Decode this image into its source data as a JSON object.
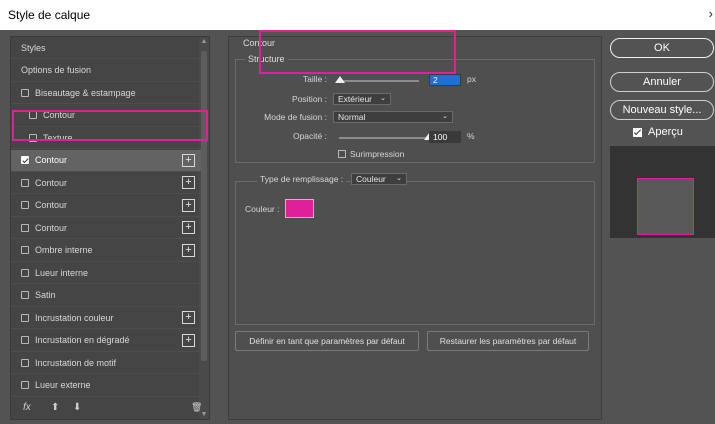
{
  "window": {
    "title": "Style de calque",
    "close_glyph": "›"
  },
  "left_panel": {
    "items": [
      {
        "label": "Styles",
        "checkbox": false,
        "checked": false,
        "plus": false,
        "selected": false
      },
      {
        "label": "Options de fusion",
        "checkbox": false,
        "checked": false,
        "plus": false,
        "selected": false
      },
      {
        "label": "Biseautage & estampage",
        "checkbox": true,
        "checked": false,
        "plus": false,
        "selected": false
      },
      {
        "label": "Contour",
        "checkbox": true,
        "checked": false,
        "plus": false,
        "selected": false,
        "indent": true
      },
      {
        "label": "Texture",
        "checkbox": true,
        "checked": false,
        "plus": false,
        "selected": false,
        "indent": true
      },
      {
        "label": "Contour",
        "checkbox": true,
        "checked": true,
        "plus": true,
        "selected": true
      },
      {
        "label": "Contour",
        "checkbox": true,
        "checked": false,
        "plus": true,
        "selected": false
      },
      {
        "label": "Contour",
        "checkbox": true,
        "checked": false,
        "plus": true,
        "selected": false
      },
      {
        "label": "Contour",
        "checkbox": true,
        "checked": false,
        "plus": true,
        "selected": false
      },
      {
        "label": "Ombre interne",
        "checkbox": true,
        "checked": false,
        "plus": true,
        "selected": false
      },
      {
        "label": "Lueur interne",
        "checkbox": true,
        "checked": false,
        "plus": false,
        "selected": false
      },
      {
        "label": "Satin",
        "checkbox": true,
        "checked": false,
        "plus": false,
        "selected": false
      },
      {
        "label": "Incrustation couleur",
        "checkbox": true,
        "checked": false,
        "plus": true,
        "selected": false
      },
      {
        "label": "Incrustation en dégradé",
        "checkbox": true,
        "checked": false,
        "plus": true,
        "selected": false
      },
      {
        "label": "Incrustation de motif",
        "checkbox": true,
        "checked": false,
        "plus": false,
        "selected": false
      },
      {
        "label": "Lueur externe",
        "checkbox": true,
        "checked": false,
        "plus": false,
        "selected": false
      }
    ],
    "footer": {
      "fx": "fx",
      "up_glyph": "⬆",
      "down_glyph": "⬇",
      "trash_glyph": "🗑"
    }
  },
  "contour_panel": {
    "group_title": "Contour",
    "structure_title": "Structure",
    "taille_label": "Taille :",
    "taille_value": "2",
    "taille_unit": "px",
    "taille_fraction": 0.01,
    "position_label": "Position :",
    "position_value": "Extérieur",
    "mode_label": "Mode de fusion :",
    "mode_value": "Normal",
    "opacite_label": "Opacité :",
    "opacite_value": "100",
    "opacite_unit": "%",
    "opacite_fraction": 1.0,
    "surimpression_label": "Surimpression",
    "remplissage_label": "Type de remplissage :",
    "remplissage_value": "Couleur",
    "couleur_label": "Couleur :",
    "couleur_hex": "#e0209a"
  },
  "buttons": {
    "defaut": "Définir en tant que paramètres par défaut",
    "restaurer": "Restaurer les paramètres par défaut",
    "ok": "OK",
    "annuler": "Annuler",
    "nouveau": "Nouveau style...",
    "apercu": "Aperçu"
  },
  "colors": {
    "accent": "#e0209a",
    "selection": "#1e6fd8",
    "panel": "#535353"
  }
}
